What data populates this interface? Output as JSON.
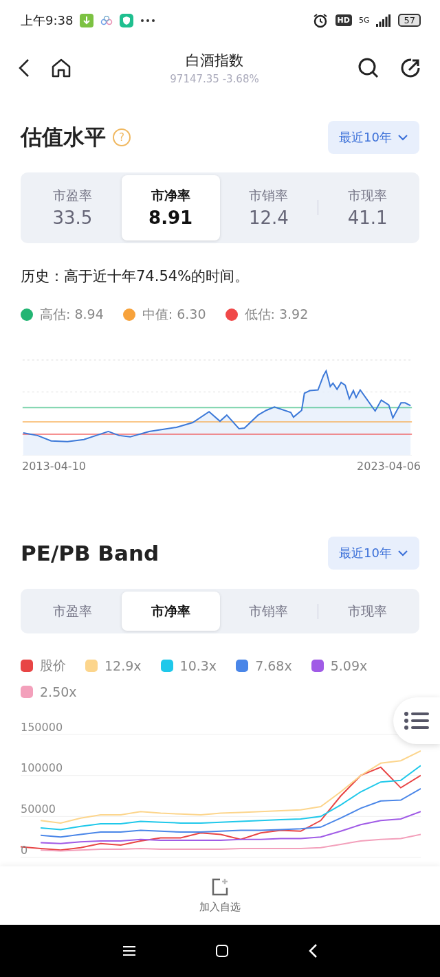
{
  "status_bar": {
    "time": "上午9:38",
    "hd": "HD",
    "network": "5G",
    "battery": "57"
  },
  "header": {
    "title": "白酒指数",
    "subtitle": "97147.35 -3.68%"
  },
  "valuation": {
    "title": "估值水平",
    "help": "?",
    "period": "最近10年",
    "tabs": [
      {
        "label": "市盈率",
        "value": "33.5",
        "selected": false
      },
      {
        "label": "市净率",
        "value": "8.91",
        "selected": true
      },
      {
        "label": "市销率",
        "value": "12.4",
        "selected": false
      },
      {
        "label": "市现率",
        "value": "41.1",
        "selected": false
      }
    ],
    "history": "历史：高于近十年74.54%的时间。",
    "legend": [
      {
        "label": "高估: 8.94",
        "color": "#22b573"
      },
      {
        "label": "中值: 6.30",
        "color": "#f7a23b"
      },
      {
        "label": "低估: 3.92",
        "color": "#f04848"
      }
    ],
    "start_date": "2013-04-10",
    "end_date": "2023-04-06"
  },
  "band": {
    "title": "PE/PB Band",
    "period": "最近10年",
    "tabs": [
      {
        "label": "市盈率",
        "selected": false
      },
      {
        "label": "市净率",
        "selected": true
      },
      {
        "label": "市销率",
        "selected": false
      },
      {
        "label": "市现率",
        "selected": false
      }
    ],
    "chart_data": {
      "type": "line",
      "ylim": [
        0,
        150000
      ],
      "yticks": [
        0,
        50000,
        100000,
        150000
      ],
      "series": [
        {
          "name": "股价",
          "color": "#e84545",
          "values": [
            13000,
            11000,
            9000,
            12000,
            17000,
            15000,
            20000,
            24000,
            24000,
            30000,
            28000,
            22000,
            30000,
            33000,
            32000,
            45000,
            75000,
            100000,
            110000,
            85000,
            100000
          ]
        },
        {
          "name": "12.9x",
          "color": "#fcd58c",
          "values": [
            null,
            45000,
            42000,
            48000,
            52000,
            52000,
            56000,
            54000,
            53000,
            52000,
            54000,
            55000,
            56000,
            57000,
            58000,
            62000,
            80000,
            100000,
            115000,
            118000,
            130000
          ]
        },
        {
          "name": "10.3x",
          "color": "#1fc8ea",
          "values": [
            null,
            36000,
            34000,
            38000,
            41000,
            41000,
            44000,
            43000,
            42000,
            42000,
            43000,
            44000,
            45000,
            46000,
            47000,
            50000,
            64000,
            80000,
            92000,
            94000,
            112000
          ]
        },
        {
          "name": "7.68x",
          "color": "#4a86e8",
          "values": [
            null,
            27000,
            25000,
            28000,
            31000,
            31000,
            33000,
            32000,
            31000,
            31000,
            32000,
            33000,
            33000,
            34000,
            35000,
            37000,
            48000,
            60000,
            69000,
            70000,
            84000
          ]
        },
        {
          "name": "5.09x",
          "color": "#a05be6",
          "values": [
            null,
            18000,
            17000,
            19000,
            20000,
            20000,
            22000,
            21000,
            21000,
            21000,
            21000,
            22000,
            22000,
            23000,
            23000,
            25000,
            32000,
            40000,
            45000,
            47000,
            56000
          ]
        },
        {
          "name": "2.50x",
          "color": "#f3a0bb",
          "values": [
            null,
            9000,
            8000,
            9000,
            10000,
            10000,
            11000,
            10000,
            10000,
            10000,
            10000,
            11000,
            11000,
            11000,
            11000,
            12000,
            16000,
            20000,
            22000,
            23000,
            28000
          ]
        }
      ]
    }
  },
  "bottom": {
    "label": "加入自选"
  }
}
